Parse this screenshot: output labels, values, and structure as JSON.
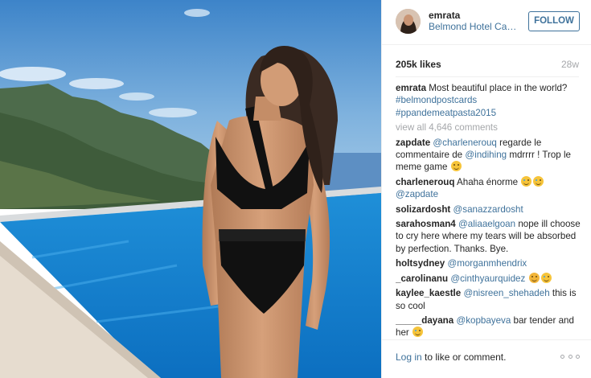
{
  "post": {
    "owner": "emrata",
    "location": "Belmond Hotel Car...",
    "follow_label": "FOLLOW",
    "likes": "205k likes",
    "time_ago": "28w",
    "caption": {
      "user": "emrata",
      "text": "Most beautiful place in the world?",
      "tags": [
        "#belmondpostcards",
        "#ppandemeatpasta2015"
      ]
    },
    "view_all": "view all 4,646 comments",
    "comments": [
      {
        "user": "zapdate",
        "mention": "@charlenerouq",
        "text": " regarde le commentaire de ",
        "mention2": "@indihing",
        "text2": " mdrrrr ! Trop le meme game",
        "emoji": "laughing-emoji"
      },
      {
        "user": "charlenerouq",
        "text": "Ahaha énorme",
        "emoji": "crying-laughing-emoji",
        "mention": "@zapdate"
      },
      {
        "user": "solizardosht",
        "mention": "@sanazzardosht"
      },
      {
        "user": "sarahosman4",
        "mention": "@aliaaelgoan",
        "text": " nope ill choose to cry here where my tears will be absorbed by perfection. Thanks. Bye."
      },
      {
        "user": "holtsydney",
        "mention": "@morganmhendrix"
      },
      {
        "user": "_carolinanu",
        "mention": "@cinthyaurquidez",
        "emoji": "blushing-emoji"
      },
      {
        "user": "kaylee_kaestle",
        "mention": "@nisreen_shehadeh",
        "text": " this is so cool"
      },
      {
        "user": "_____dayana",
        "mention": "@kopbayeva",
        "text": " bar tender and her"
      }
    ],
    "footer": {
      "login_link": "Log in",
      "login_text": " to like or comment."
    },
    "colors": {
      "link": "#3f729b",
      "muted": "#a5a7aa",
      "text": "#262626"
    }
  }
}
